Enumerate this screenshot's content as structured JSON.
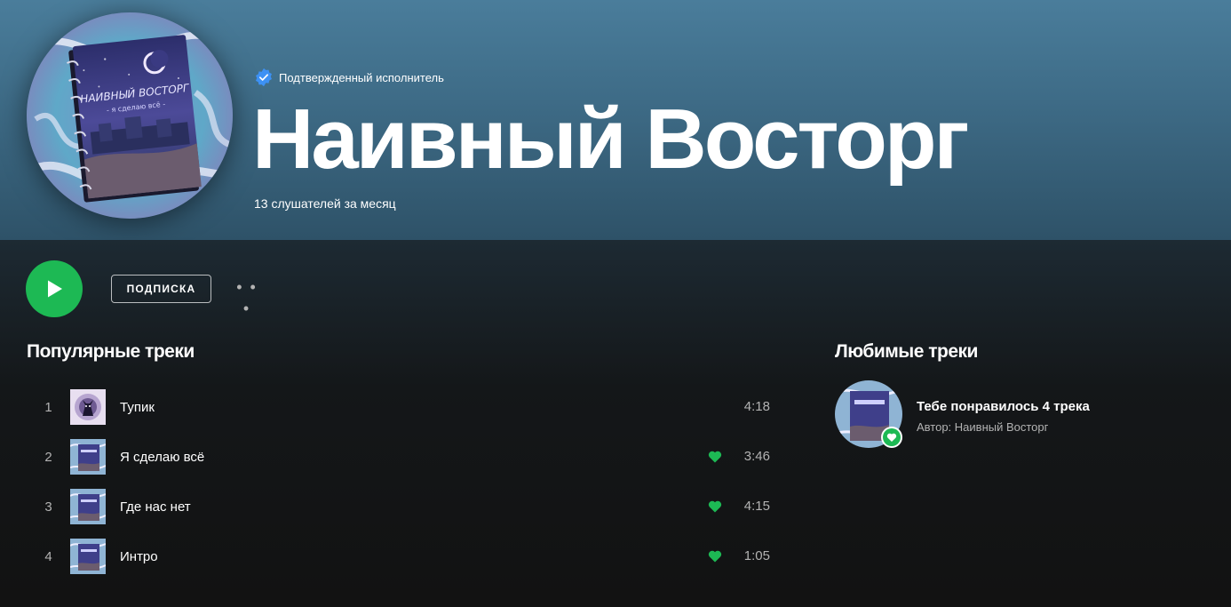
{
  "artist": {
    "verified_label": "Подтвержденный исполнитель",
    "name": "Наивный Восторг",
    "monthly_listeners": "13 слушателей за месяц",
    "avatar_icon": "album-art-notebook-icon"
  },
  "actions": {
    "play_icon": "play-icon",
    "follow_label": "ПОДПИСКА",
    "more_label": "• • •"
  },
  "popular": {
    "title": "Популярные треки",
    "tracks": [
      {
        "num": "1",
        "title": "Тупик",
        "duration": "4:18",
        "liked": false,
        "cover": "dark-figure-cover"
      },
      {
        "num": "2",
        "title": "Я сделаю всё",
        "duration": "3:46",
        "liked": true,
        "cover": "notebook-cover"
      },
      {
        "num": "3",
        "title": "Где нас нет",
        "duration": "4:15",
        "liked": true,
        "cover": "notebook-cover"
      },
      {
        "num": "4",
        "title": "Интро",
        "duration": "1:05",
        "liked": true,
        "cover": "notebook-cover"
      }
    ]
  },
  "liked": {
    "title": "Любимые треки",
    "card_title": "Тебе понравилось 4 трека",
    "card_subtitle": "Автор: Наивный Восторг"
  },
  "colors": {
    "accent": "#1db954",
    "header_bg": "#4a7d9b",
    "body_bg": "#121212",
    "verified": "#3d91f4"
  }
}
